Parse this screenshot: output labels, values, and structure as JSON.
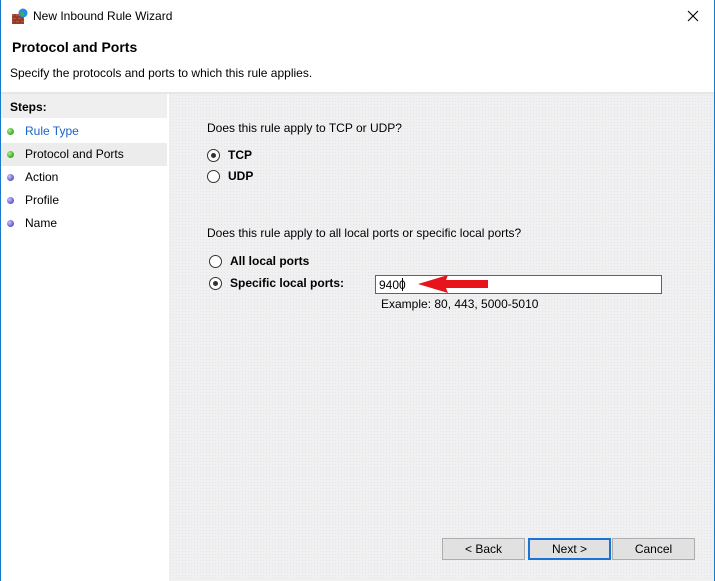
{
  "window": {
    "title": "New Inbound Rule Wizard",
    "icon": "firewall-globe-icon",
    "close_icon": "close-icon"
  },
  "header": {
    "title": "Protocol and Ports",
    "subtitle": "Specify the protocols and ports to which this rule applies."
  },
  "steps": {
    "heading": "Steps:",
    "items": [
      {
        "label": "Rule Type",
        "status": "done",
        "link": true
      },
      {
        "label": "Protocol and Ports",
        "status": "done",
        "current": true
      },
      {
        "label": "Action",
        "status": "pending"
      },
      {
        "label": "Profile",
        "status": "pending"
      },
      {
        "label": "Name",
        "status": "pending"
      }
    ]
  },
  "protocol": {
    "question": "Does this rule apply to TCP or UDP?",
    "options": [
      {
        "label": "TCP",
        "selected": true
      },
      {
        "label": "UDP",
        "selected": false
      }
    ]
  },
  "ports": {
    "question": "Does this rule apply to all local ports or specific local ports?",
    "options": [
      {
        "label": "All local ports",
        "selected": false
      },
      {
        "label": "Specific local ports:",
        "selected": true
      }
    ],
    "value": "9400",
    "example": "Example: 80, 443, 5000-5010"
  },
  "annotation": {
    "type": "red-arrow",
    "color": "#e8141c",
    "points_to": "specific-ports-input"
  },
  "buttons": {
    "back": "< Back",
    "next": "Next >",
    "cancel": "Cancel"
  },
  "colors": {
    "accent": "#1a73d6",
    "link": "#1a64c8"
  }
}
